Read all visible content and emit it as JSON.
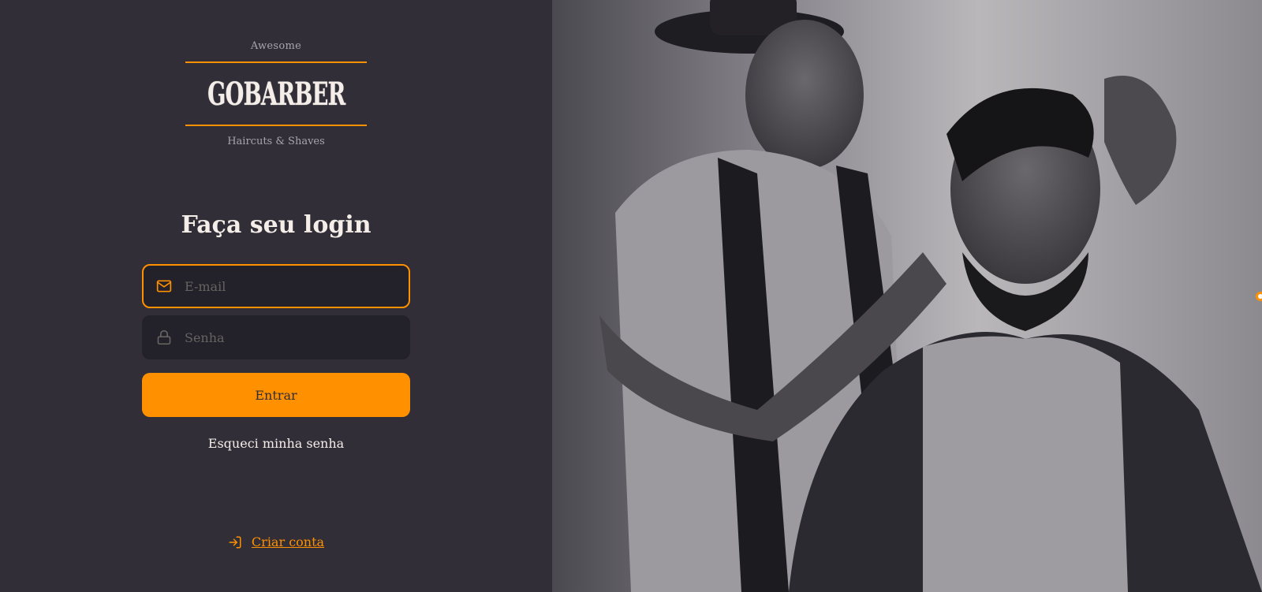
{
  "logo": {
    "top_text": "Awesome",
    "brand": "GOBARBER",
    "bottom_text": "Haircuts & Shaves"
  },
  "form": {
    "title": "Faça seu login",
    "email": {
      "placeholder": "E-mail",
      "value": "",
      "icon": "mail-icon"
    },
    "password": {
      "placeholder": "Senha",
      "value": "",
      "icon": "lock-icon"
    },
    "submit_label": "Entrar",
    "forgot_label": "Esqueci minha senha"
  },
  "footer": {
    "create_label": "Criar conta",
    "icon": "log-in-icon"
  },
  "colors": {
    "background": "#312e38",
    "input_bg": "#232129",
    "accent": "#ff9000",
    "text": "#f4ede8",
    "placeholder": "#666360"
  }
}
